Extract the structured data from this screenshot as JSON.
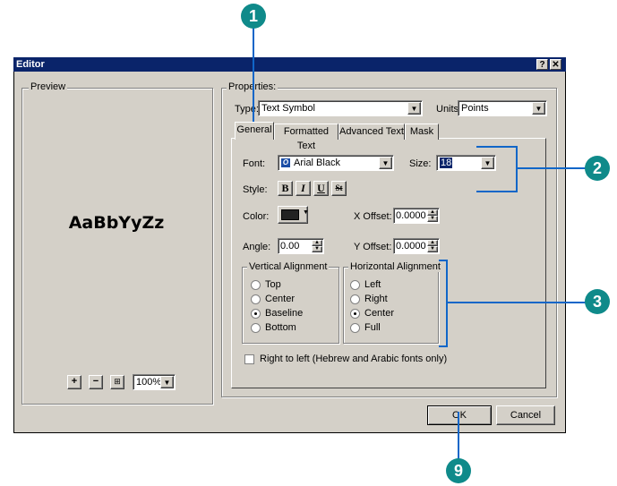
{
  "window": {
    "title": "Editor",
    "help_btn": "?",
    "close_btn": "✕"
  },
  "preview": {
    "group_label": "Preview",
    "sample_text": "AaBbYyZz",
    "zoom_in": "+",
    "zoom_out": "−",
    "fit": "⊞",
    "zoom_value": "100%"
  },
  "properties": {
    "group_label": "Properties:",
    "type_label": "Type:",
    "type_value": "Text Symbol",
    "units_label": "Units:",
    "units_value": "Points",
    "tabs": [
      {
        "label": "General",
        "active": true
      },
      {
        "label": "Formatted Text",
        "active": false
      },
      {
        "label": "Advanced Text",
        "active": false
      },
      {
        "label": "Mask",
        "active": false
      }
    ]
  },
  "general": {
    "font_label": "Font:",
    "font_value": "Arial Black",
    "size_label": "Size:",
    "size_value": "18",
    "style_label": "Style:",
    "style_buttons": [
      "B",
      "I",
      "U",
      "St"
    ],
    "color_label": "Color:",
    "color_value": "#222222",
    "xoffset_label": "X Offset:",
    "xoffset_value": "0.0000",
    "angle_label": "Angle:",
    "angle_value": "0.00",
    "yoffset_label": "Y Offset:",
    "yoffset_value": "0.0000",
    "valign_label": "Vertical Alignment",
    "valign_options": [
      {
        "label": "Top",
        "selected": false
      },
      {
        "label": "Center",
        "selected": false
      },
      {
        "label": "Baseline",
        "selected": true
      },
      {
        "label": "Bottom",
        "selected": false
      }
    ],
    "halign_label": "Horizontal Alignment",
    "halign_options": [
      {
        "label": "Left",
        "selected": false
      },
      {
        "label": "Right",
        "selected": false
      },
      {
        "label": "Center",
        "selected": true
      },
      {
        "label": "Full",
        "selected": false
      }
    ],
    "rtl_label": "Right to left (Hebrew and Arabic fonts only)",
    "rtl_checked": false
  },
  "buttons": {
    "ok": "OK",
    "cancel": "Cancel"
  },
  "callouts": {
    "c1": "1",
    "c2": "2",
    "c3": "3",
    "c9": "9"
  },
  "colors": {
    "callout": "#0f8a8a",
    "bracket": "#1066c8",
    "titlebar": "#0a246a"
  }
}
